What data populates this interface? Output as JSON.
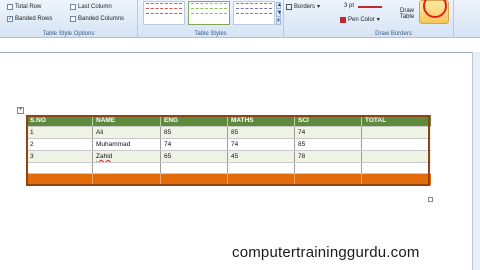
{
  "ribbon": {
    "table_style_options": {
      "caption": "Table Style Options",
      "total_row": "Total Row",
      "banded_rows": "Banded Rows",
      "last_column": "Last Column",
      "banded_columns": "Banded Columns"
    },
    "table_styles": {
      "caption": "Table Styles"
    },
    "borders_label": "Borders",
    "draw_borders": {
      "caption": "Draw Borders",
      "pen_weight": "3 pt",
      "pen_color_label": "Pen Color",
      "draw_table_label": "Draw Table",
      "pen_color": "#c0282d"
    }
  },
  "table": {
    "headers": [
      "S.NO",
      "NAME",
      "ENG",
      "MATHS",
      "SCI",
      "TOTAL"
    ],
    "rows": [
      [
        "1",
        "Ali",
        "85",
        "85",
        "74",
        ""
      ],
      [
        "2",
        "Muhammad",
        "74",
        "74",
        "85",
        ""
      ],
      [
        "3",
        "Zahid",
        "65",
        "45",
        "78",
        ""
      ]
    ],
    "header_color": "#5e8a3c",
    "last_row_color": "#e36c0a"
  },
  "watermark": "computertraininggurdu.com"
}
